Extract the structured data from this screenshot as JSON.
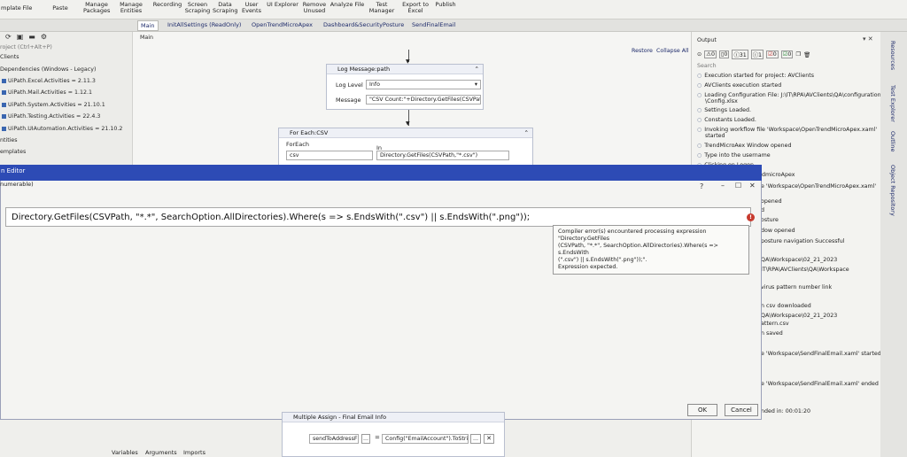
{
  "ribbon": {
    "items": [
      "mplate",
      "File",
      "Paste",
      "Manage Packages",
      "Manage Entities",
      "Recording",
      "Screen Scraping",
      "Data Scraping",
      "User Events",
      "UI Explorer",
      "Remove Unused",
      "Analyze File",
      "Test Manager",
      "Export to Excel",
      "Publish"
    ]
  },
  "tabs": {
    "items": [
      "Main",
      "InitAllSettings (ReadOnly)",
      "OpenTrendMicroApex",
      "Dashboard&SecurityPosture",
      "SendFinalEmail"
    ]
  },
  "left_panel": {
    "search_placeholder": "roject (Ctrl+Alt+P)",
    "items": [
      "Clients",
      "Dependencies (Windows - Legacy)",
      "UiPath.Excel.Activities = 2.11.3",
      "UiPath.Mail.Activities = 1.12.1",
      "UiPath.System.Activities = 21.10.1",
      "UiPath.Testing.Activities = 22.4.3",
      "UiPath.UIAutomation.Activities = 21.10.2",
      "ntities",
      "emplates"
    ]
  },
  "designer": {
    "breadcrumb": "Main",
    "restore_label": "Restore",
    "collapse_label": "Collapse All",
    "log_title": "Log Message:path",
    "log_level_label": "Log Level",
    "log_level_value": "Info",
    "message_label": "Message",
    "message_value": "\"CSV Count:\"+Directory.GetFiles(CSVPath,\"",
    "foreach_title": "For Each:CSV",
    "foreach_label": "ForEach",
    "foreach_var": "csv",
    "in_label": "In",
    "in_value": "Directory.GetFiles(CSVPath,\"*.csv\")"
  },
  "dialog": {
    "title": "n Editor",
    "type_hint": "numerable)",
    "help": "?",
    "minimize": "–",
    "maximize": "☐",
    "close": "✕",
    "expression": "Directory.GetFiles(CSVPath, \"*.*\", SearchOption.AllDirectories).Where(s => s.EndsWith(\".csv\") || s.EndsWith(\".png\"));",
    "error_lines": [
      "Compiler error(s) encountered processing expression \"Directory.GetFiles",
      "(CSVPath, \"*.*\", SearchOption.AllDirectories).Where(s => s.EndsWith",
      "(\".csv\") || s.EndsWith(\".png\"));\".",
      "Expression expected."
    ],
    "ok": "OK",
    "cancel": "Cancel"
  },
  "output": {
    "title": "Output",
    "counts": [
      "0",
      "0",
      "31",
      "1",
      "0",
      "0"
    ],
    "search_placeholder": "Search",
    "lines": [
      "Execution started for project: AVClients",
      "AVClients execution started",
      "Loading Configuration File: J:\\IT\\RPA\\AVClients\\QA\\configuration",
      "\\Config.xlsx",
      "Settings Loaded.",
      "Constants Loaded.",
      "Invoking workflow file 'Workspace\\OpenTrendMicroApex.xaml'",
      "started",
      "TrendMicroAex Window opened",
      "Type into  the username",
      "Clicking on Logon",
      "Logged into the TrendmicroApex",
      "e 'Workspace\\OpenTrendMicroApex.xaml'",
      "opened",
      "d",
      "osture",
      "dow opened",
      "posture navigation Successful",
      "QA\\Workspace\\02_21_2023",
      "IT\\RPA\\AVClients\\QA\\Workspace",
      "virus pattern number link",
      "n csv downloaded",
      "QA\\Workspace\\02_21_2023",
      "attern.csv",
      "n saved",
      "e 'Workspace\\SendFinalEmail.xaml' started",
      "e 'Workspace\\SendFinalEmail.xaml' ended",
      "nded in: 00:01:20"
    ]
  },
  "right_sidebar": {
    "items": [
      "Resources",
      "Test Explorer",
      "Outline",
      "Object Repository"
    ]
  },
  "bottom": {
    "assign_title": "Multiple Assign - Final Email Info",
    "assign_var": "sendToAddressF",
    "assign_value": "Config(\"EmailAccount\").ToStri",
    "tabs": [
      "Variables",
      "Arguments",
      "Imports"
    ]
  }
}
